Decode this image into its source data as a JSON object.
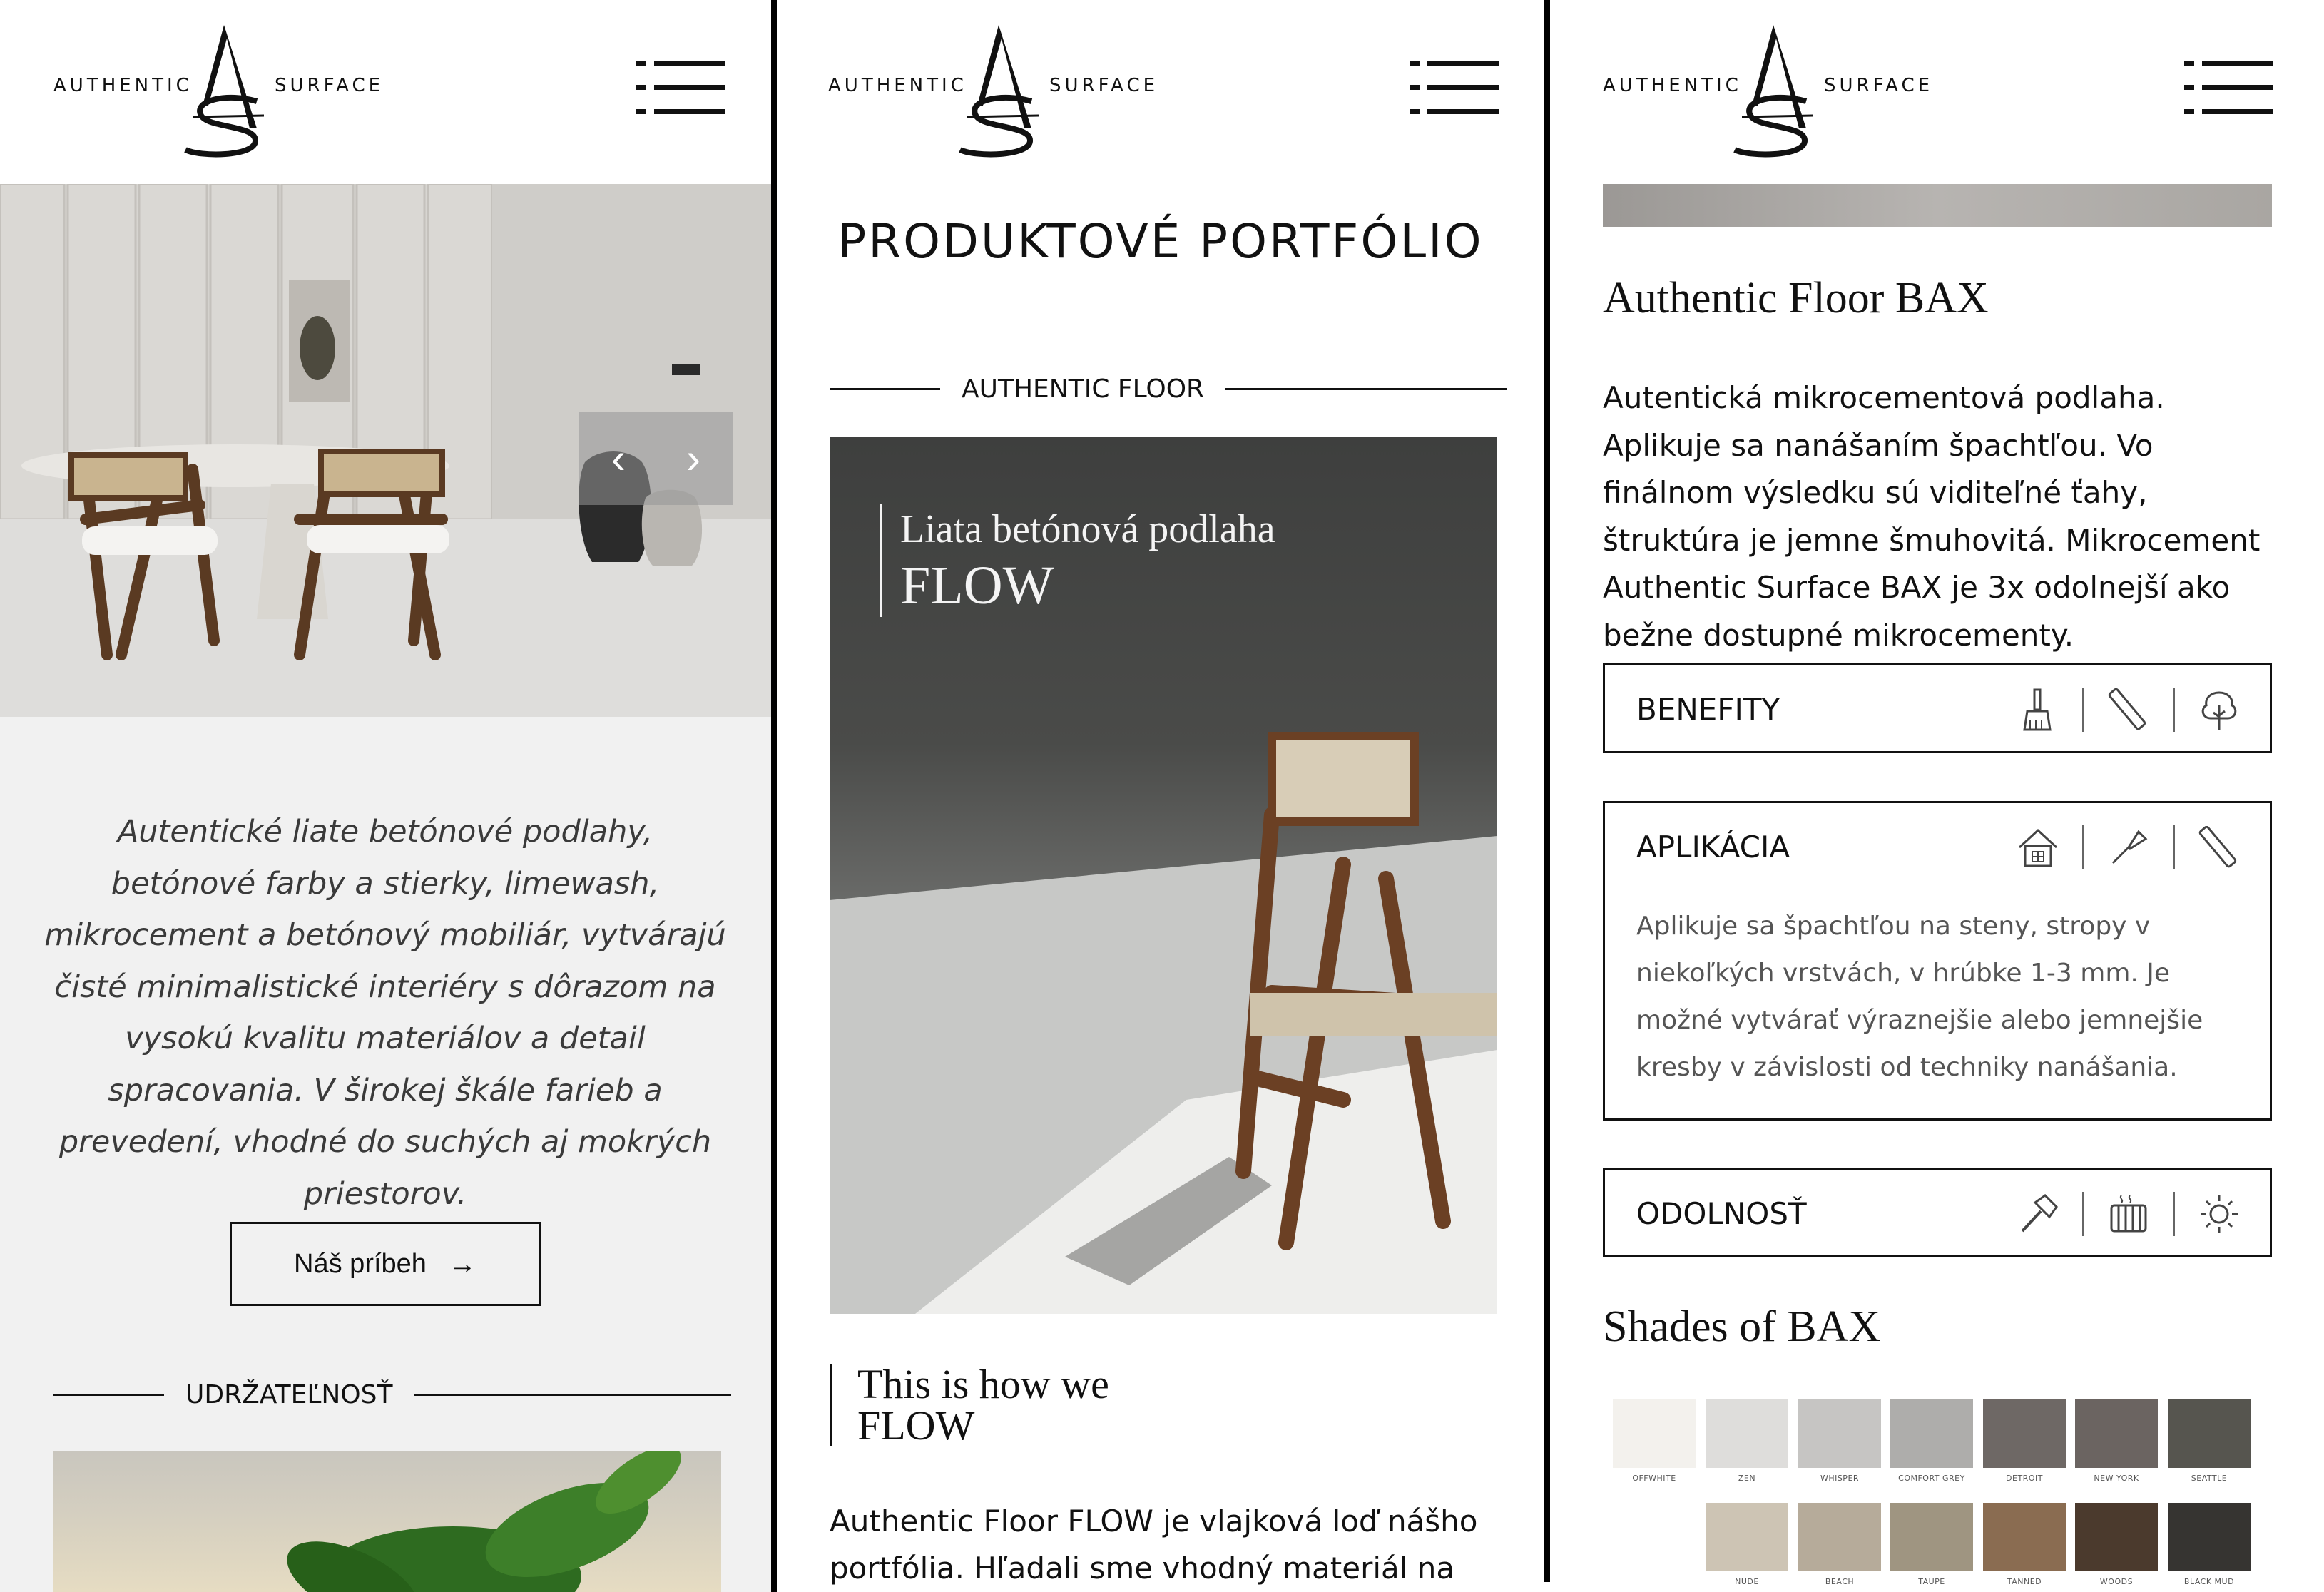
{
  "brand": {
    "left": "AUTHENTIC",
    "right": "SURFACE"
  },
  "panel1": {
    "slider": {
      "prev": "‹",
      "next": "›"
    },
    "intro": "Autentické liate betónové podlahy, betónové farby a stierky, limewash, mikrocement a betónový mobiliár, vytvárajú čisté minimalistické interiéry s dôrazom na vysokú kvalitu materiálov a detail spracovania. V širokej škále farieb a prevedení, vhodné do suchých aj mokrých priestorov.",
    "button_label": "Náš príbeh",
    "button_arrow": "→",
    "section": "UDRŽATEĽNOSŤ"
  },
  "panel2": {
    "title": "PRODUKTOVÉ PORTFÓLIO",
    "section": "AUTHENTIC FLOOR",
    "hero_caption": {
      "line1": "Liata betónová podlaha",
      "line2": "FLOW"
    },
    "quote": {
      "line1": "This is how we",
      "line2": "FLOW"
    },
    "body": "Authentic Floor FLOW je vlajková loď nášho portfólia. Hľadali sme vhodný materiál na"
  },
  "panel3": {
    "heading": "Authentic Floor BAX",
    "description": "Autentická mikrocementová podlaha. Aplikuje sa nanášaním špachtľou. Vo finálnom výsledku sú viditeľné ťahy, štruktúra je jemne šmuhovitá. Mikrocement Authentic Surface BAX je 3x odolnejší ako bežne dostupné mikrocementy.",
    "accordions": [
      {
        "title": "BENEFITY",
        "icons": [
          "brush-icon",
          "trowel-icon",
          "tree-icon"
        ]
      },
      {
        "title": "APLIKÁCIA",
        "icons": [
          "house-icon",
          "spatula-icon",
          "trowel-icon"
        ],
        "body": "Aplikuje sa špachtľou na steny, stropy v niekoľkých vrstvách, v hrúbke 1-3 mm. Je možné vytvárať výraznejšie alebo jemnejšie kresby v závislosti od techniky nanášania."
      },
      {
        "title": "ODOLNOSŤ",
        "icons": [
          "hammer-icon",
          "radiator-icon",
          "sun-icon"
        ]
      }
    ],
    "shades_title": "Shades of BAX",
    "shades": [
      {
        "name": "OFFWHITE",
        "color": "#f3f1ed"
      },
      {
        "name": "ZEN",
        "color": "#dedddb"
      },
      {
        "name": "WHISPER",
        "color": "#c6c5c3"
      },
      {
        "name": "COMFORT GREY",
        "color": "#aeadab"
      },
      {
        "name": "DETROIT",
        "color": "#6e6865"
      },
      {
        "name": "NEW YORK",
        "color": "#6b6461"
      },
      {
        "name": "SEATTLE",
        "color": "#56554f"
      },
      {
        "name": "NUDE",
        "color": "#cdc4b4"
      },
      {
        "name": "BEACH",
        "color": "#b6ab9a"
      },
      {
        "name": "TAUPE",
        "color": "#9f9581"
      },
      {
        "name": "TANNED",
        "color": "#8a6c51"
      },
      {
        "name": "WOODS",
        "color": "#4b3a2d"
      },
      {
        "name": "BLACK MUD",
        "color": "#363431"
      }
    ]
  }
}
